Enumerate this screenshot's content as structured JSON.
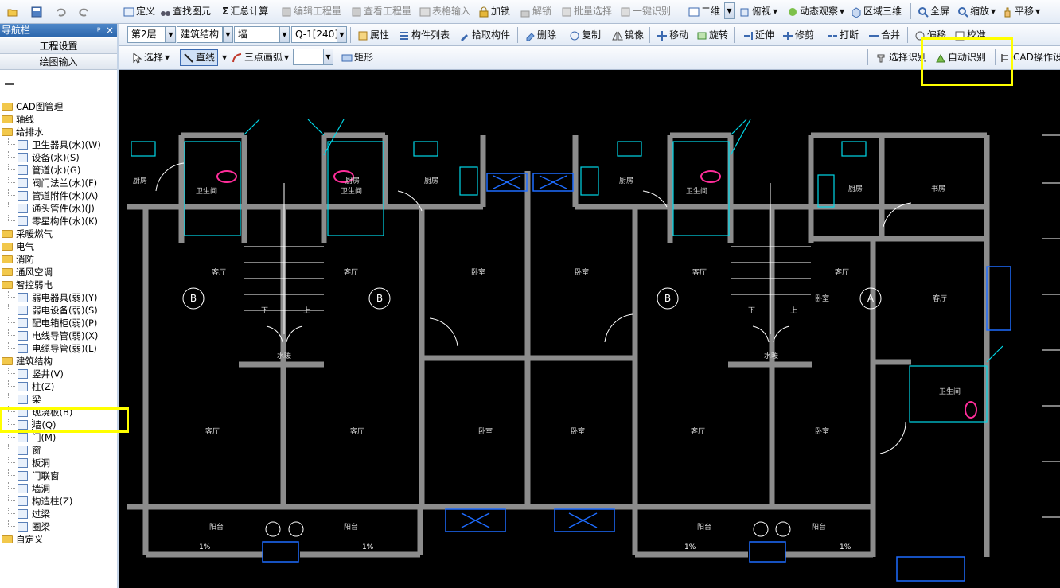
{
  "quick_access": {
    "icons": [
      "open-folder-icon",
      "save-icon",
      "undo-icon",
      "redo-icon"
    ]
  },
  "toolbar1": {
    "define": "定义",
    "find_element": "查找图元",
    "summary_calc": "汇总计算",
    "edit_project": "编辑工程量",
    "view_project": "查看工程量",
    "table_input": "表格输入",
    "lock": "加锁",
    "unlock": "解锁",
    "batch_select": "批量选择",
    "one_click_identify": "一键识别",
    "view_mode": "二维",
    "top_view": "俯视",
    "dynamic_observe": "动态观察",
    "area_3d": "区域三维",
    "fullscreen": "全屏",
    "zoom": "缩放",
    "pan": "平移"
  },
  "toolbar2": {
    "floor": "第2层",
    "category": "建筑结构",
    "element_type": "墙",
    "element_name": "Q-1[240]",
    "properties": "属性",
    "element_list": "构件列表",
    "pick_element": "拾取构件",
    "delete": "删除",
    "copy": "复制",
    "mirror": "镜像",
    "move": "移动",
    "rotate": "旋转",
    "extend": "延伸",
    "trim": "修剪",
    "break": "打断",
    "merge": "合并",
    "offset": "偏移",
    "align": "校准"
  },
  "toolbar3": {
    "select": "选择",
    "line": "直线",
    "arc": "三点画弧",
    "combo_value": "",
    "rect": "矩形",
    "select_identify": "选择识别",
    "auto_identify": "自动识别",
    "cad_ops": "CAD操作设"
  },
  "nav": {
    "title": "导航栏",
    "pin": "ᵖ",
    "close": "×",
    "project_settings": "工程设置",
    "drawing_input": "绘图输入",
    "tree": [
      {
        "label": "CAD图管理",
        "level": 0
      },
      {
        "label": "轴线",
        "level": 0
      },
      {
        "label": "给排水",
        "level": 0
      },
      {
        "label": "卫生器具(水)(W)",
        "level": 1
      },
      {
        "label": "设备(水)(S)",
        "level": 1
      },
      {
        "label": "管道(水)(G)",
        "level": 1
      },
      {
        "label": "阀门法兰(水)(F)",
        "level": 1
      },
      {
        "label": "管道附件(水)(A)",
        "level": 1
      },
      {
        "label": "通头管件(水)(J)",
        "level": 1
      },
      {
        "label": "零星构件(水)(K)",
        "level": 1
      },
      {
        "label": "采暖燃气",
        "level": 0
      },
      {
        "label": "电气",
        "level": 0
      },
      {
        "label": "消防",
        "level": 0
      },
      {
        "label": "通风空调",
        "level": 0
      },
      {
        "label": "智控弱电",
        "level": 0
      },
      {
        "label": "弱电器具(弱)(Y)",
        "level": 1
      },
      {
        "label": "弱电设备(弱)(S)",
        "level": 1
      },
      {
        "label": "配电箱柜(弱)(P)",
        "level": 1
      },
      {
        "label": "电线导管(弱)(X)",
        "level": 1
      },
      {
        "label": "电缆导管(弱)(L)",
        "level": 1
      },
      {
        "label": "建筑结构",
        "level": 0
      },
      {
        "label": "竖井(V)",
        "level": 1
      },
      {
        "label": "柱(Z)",
        "level": 1
      },
      {
        "label": "梁",
        "level": 1
      },
      {
        "label": "现浇板(B)",
        "level": 1
      },
      {
        "label": "墙(Q)",
        "level": 1
      },
      {
        "label": "门(M)",
        "level": 1
      },
      {
        "label": "窗",
        "level": 1
      },
      {
        "label": "板洞",
        "level": 1
      },
      {
        "label": "门联窗",
        "level": 1
      },
      {
        "label": "墙洞",
        "level": 1
      },
      {
        "label": "构造柱(Z)",
        "level": 1
      },
      {
        "label": "过梁",
        "level": 1
      },
      {
        "label": "圈梁",
        "level": 1
      },
      {
        "label": "自定义",
        "level": 0
      }
    ]
  },
  "drawing": {
    "rooms": [
      "厨房",
      "卫生间",
      "厨房",
      "卫生间",
      "厨房",
      "厨房",
      "卫生间",
      "厨房",
      "书房",
      "客厅",
      "客厅",
      "卧室",
      "卧室",
      "客厅",
      "客厅",
      "客厅",
      "客厅",
      "卧室",
      "卧室",
      "客厅",
      "卧室",
      "客厅",
      "卧室",
      "卫生间",
      "阳台",
      "阳台",
      "阳台",
      "阳台",
      "水暖",
      "水暖",
      "下",
      "上",
      "下",
      "上"
    ],
    "axis_labels": [
      "B",
      "B",
      "B",
      "A"
    ],
    "slopes": [
      "1%",
      "1%",
      "1%",
      "1%"
    ]
  },
  "colors": {
    "highlight": "#ffff00",
    "wall": "#8c8c8c",
    "fixture_cyan": "#00d8e8",
    "fixture_magenta": "#ff2d9a",
    "window_blue": "#1e6cff"
  }
}
